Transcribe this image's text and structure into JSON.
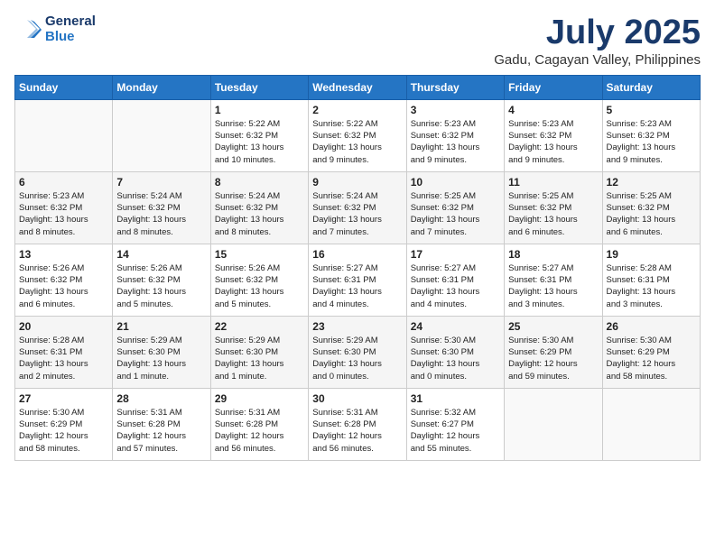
{
  "header": {
    "logo_line1": "General",
    "logo_line2": "Blue",
    "title": "July 2025",
    "subtitle": "Gadu, Cagayan Valley, Philippines"
  },
  "weekdays": [
    "Sunday",
    "Monday",
    "Tuesday",
    "Wednesday",
    "Thursday",
    "Friday",
    "Saturday"
  ],
  "weeks": [
    [
      {
        "day": "",
        "info": ""
      },
      {
        "day": "",
        "info": ""
      },
      {
        "day": "1",
        "info": "Sunrise: 5:22 AM\nSunset: 6:32 PM\nDaylight: 13 hours\nand 10 minutes."
      },
      {
        "day": "2",
        "info": "Sunrise: 5:22 AM\nSunset: 6:32 PM\nDaylight: 13 hours\nand 9 minutes."
      },
      {
        "day": "3",
        "info": "Sunrise: 5:23 AM\nSunset: 6:32 PM\nDaylight: 13 hours\nand 9 minutes."
      },
      {
        "day": "4",
        "info": "Sunrise: 5:23 AM\nSunset: 6:32 PM\nDaylight: 13 hours\nand 9 minutes."
      },
      {
        "day": "5",
        "info": "Sunrise: 5:23 AM\nSunset: 6:32 PM\nDaylight: 13 hours\nand 9 minutes."
      }
    ],
    [
      {
        "day": "6",
        "info": "Sunrise: 5:23 AM\nSunset: 6:32 PM\nDaylight: 13 hours\nand 8 minutes."
      },
      {
        "day": "7",
        "info": "Sunrise: 5:24 AM\nSunset: 6:32 PM\nDaylight: 13 hours\nand 8 minutes."
      },
      {
        "day": "8",
        "info": "Sunrise: 5:24 AM\nSunset: 6:32 PM\nDaylight: 13 hours\nand 8 minutes."
      },
      {
        "day": "9",
        "info": "Sunrise: 5:24 AM\nSunset: 6:32 PM\nDaylight: 13 hours\nand 7 minutes."
      },
      {
        "day": "10",
        "info": "Sunrise: 5:25 AM\nSunset: 6:32 PM\nDaylight: 13 hours\nand 7 minutes."
      },
      {
        "day": "11",
        "info": "Sunrise: 5:25 AM\nSunset: 6:32 PM\nDaylight: 13 hours\nand 6 minutes."
      },
      {
        "day": "12",
        "info": "Sunrise: 5:25 AM\nSunset: 6:32 PM\nDaylight: 13 hours\nand 6 minutes."
      }
    ],
    [
      {
        "day": "13",
        "info": "Sunrise: 5:26 AM\nSunset: 6:32 PM\nDaylight: 13 hours\nand 6 minutes."
      },
      {
        "day": "14",
        "info": "Sunrise: 5:26 AM\nSunset: 6:32 PM\nDaylight: 13 hours\nand 5 minutes."
      },
      {
        "day": "15",
        "info": "Sunrise: 5:26 AM\nSunset: 6:32 PM\nDaylight: 13 hours\nand 5 minutes."
      },
      {
        "day": "16",
        "info": "Sunrise: 5:27 AM\nSunset: 6:31 PM\nDaylight: 13 hours\nand 4 minutes."
      },
      {
        "day": "17",
        "info": "Sunrise: 5:27 AM\nSunset: 6:31 PM\nDaylight: 13 hours\nand 4 minutes."
      },
      {
        "day": "18",
        "info": "Sunrise: 5:27 AM\nSunset: 6:31 PM\nDaylight: 13 hours\nand 3 minutes."
      },
      {
        "day": "19",
        "info": "Sunrise: 5:28 AM\nSunset: 6:31 PM\nDaylight: 13 hours\nand 3 minutes."
      }
    ],
    [
      {
        "day": "20",
        "info": "Sunrise: 5:28 AM\nSunset: 6:31 PM\nDaylight: 13 hours\nand 2 minutes."
      },
      {
        "day": "21",
        "info": "Sunrise: 5:29 AM\nSunset: 6:30 PM\nDaylight: 13 hours\nand 1 minute."
      },
      {
        "day": "22",
        "info": "Sunrise: 5:29 AM\nSunset: 6:30 PM\nDaylight: 13 hours\nand 1 minute."
      },
      {
        "day": "23",
        "info": "Sunrise: 5:29 AM\nSunset: 6:30 PM\nDaylight: 13 hours\nand 0 minutes."
      },
      {
        "day": "24",
        "info": "Sunrise: 5:30 AM\nSunset: 6:30 PM\nDaylight: 13 hours\nand 0 minutes."
      },
      {
        "day": "25",
        "info": "Sunrise: 5:30 AM\nSunset: 6:29 PM\nDaylight: 12 hours\nand 59 minutes."
      },
      {
        "day": "26",
        "info": "Sunrise: 5:30 AM\nSunset: 6:29 PM\nDaylight: 12 hours\nand 58 minutes."
      }
    ],
    [
      {
        "day": "27",
        "info": "Sunrise: 5:30 AM\nSunset: 6:29 PM\nDaylight: 12 hours\nand 58 minutes."
      },
      {
        "day": "28",
        "info": "Sunrise: 5:31 AM\nSunset: 6:28 PM\nDaylight: 12 hours\nand 57 minutes."
      },
      {
        "day": "29",
        "info": "Sunrise: 5:31 AM\nSunset: 6:28 PM\nDaylight: 12 hours\nand 56 minutes."
      },
      {
        "day": "30",
        "info": "Sunrise: 5:31 AM\nSunset: 6:28 PM\nDaylight: 12 hours\nand 56 minutes."
      },
      {
        "day": "31",
        "info": "Sunrise: 5:32 AM\nSunset: 6:27 PM\nDaylight: 12 hours\nand 55 minutes."
      },
      {
        "day": "",
        "info": ""
      },
      {
        "day": "",
        "info": ""
      }
    ]
  ]
}
